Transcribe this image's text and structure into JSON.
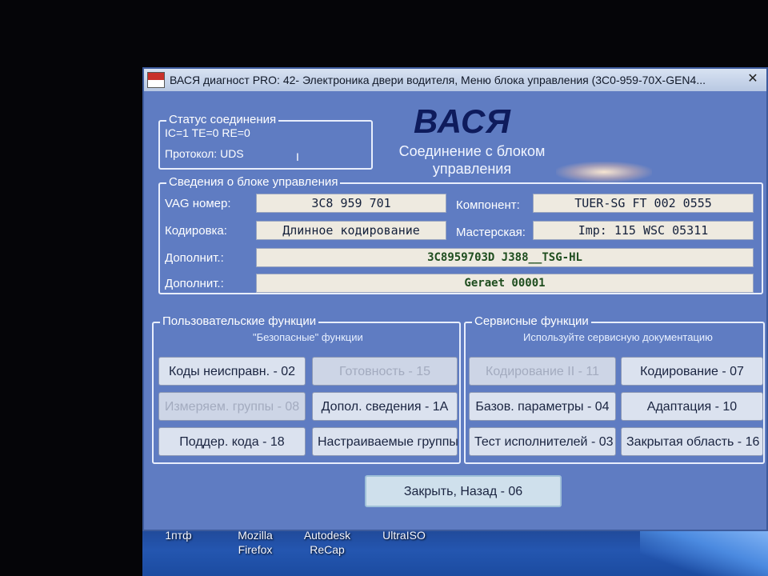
{
  "window": {
    "title": "ВАСЯ диагност PRO: 42- Электроника двери водителя,  Меню блока управления (3C0-959-70X-GEN4...",
    "close_glyph": "✕"
  },
  "status": {
    "group_title": "Статус соединения",
    "line1": "IC=1  TE=0   RE=0",
    "protocol": "Протокол: UDS",
    "indicator": "I"
  },
  "header": {
    "logo": "ВАСЯ",
    "connection_caption": "Соединение с блоком управления"
  },
  "control_info": {
    "group_title": "Сведения о блоке управления",
    "vag_label": "VAG номер:",
    "vag_value": "3C8 959 701",
    "component_label": "Компонент:",
    "component_value": "TUER-SG FT    002 0555",
    "coding_label": "Кодировка:",
    "coding_value": "Длинное кодирование",
    "workshop_label": "Мастерская:",
    "workshop_value": "Imp: 115     WSC 05311",
    "extra1_label": "Дополнит.:",
    "extra1_value": "3C8959703D J388__TSG-HL",
    "extra2_label": "Дополнит.:",
    "extra2_value": "Geraet 00001"
  },
  "user_functions": {
    "group_title": "Пользовательские функции",
    "subtitle": "\"Безопасные\" функции",
    "buttons": [
      {
        "label": "Коды неисправн. - 02",
        "enabled": true
      },
      {
        "label": "Готовность - 15",
        "enabled": false
      },
      {
        "label": "Измеряем. группы - 08",
        "enabled": false
      },
      {
        "label": "Допол. сведения - 1А",
        "enabled": true
      },
      {
        "label": "Поддер. кода - 18",
        "enabled": true
      },
      {
        "label": "Настраиваемые группы",
        "enabled": true
      }
    ]
  },
  "service_functions": {
    "group_title": "Сервисные функции",
    "subtitle": "Используйте сервисную документацию",
    "buttons": [
      {
        "label": "Кодирование II - 11",
        "enabled": false
      },
      {
        "label": "Кодирование - 07",
        "enabled": true
      },
      {
        "label": "Базов. параметры - 04",
        "enabled": true
      },
      {
        "label": "Адаптация - 10",
        "enabled": true
      },
      {
        "label": "Тест исполнителей - 03",
        "enabled": true
      },
      {
        "label": "Закрытая область - 16",
        "enabled": true
      }
    ]
  },
  "close_back": {
    "label": "Закрыть, Назад - 06"
  },
  "desktop_icons": [
    {
      "label": "1птф"
    },
    {
      "label": "Mozilla Firefox"
    },
    {
      "label": "Autodesk ReCap"
    },
    {
      "label": "UltraISO"
    }
  ]
}
